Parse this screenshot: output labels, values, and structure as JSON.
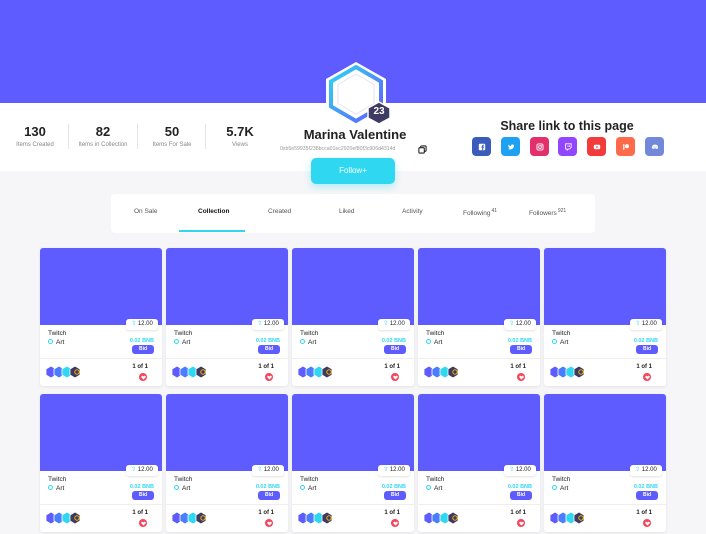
{
  "colors": {
    "brand": "#5e5bff",
    "accent": "#2fd8f0",
    "heart": "#f5455c"
  },
  "profile": {
    "name": "Marina Valentine",
    "address": "0xb5e59935f238bcca01ec2920ef80f3c906d4314d",
    "badge_count": "23",
    "follow_label": "Follow+"
  },
  "stats": [
    {
      "value": "130",
      "label": "Items Created"
    },
    {
      "value": "82",
      "label": "Items in Collection"
    },
    {
      "value": "50",
      "label": "Items For Sale"
    },
    {
      "value": "5.7K",
      "label": "Views"
    }
  ],
  "share": {
    "title": "Share link to this page",
    "networks": [
      {
        "icon": "facebook-icon",
        "color": "#3b5bbd"
      },
      {
        "icon": "twitter-icon",
        "color": "#1ea1f2"
      },
      {
        "icon": "instagram-icon",
        "color": "#e1306c"
      },
      {
        "icon": "twitch-icon",
        "color": "#9146ff"
      },
      {
        "icon": "youtube-icon",
        "color": "#f23b3b"
      },
      {
        "icon": "patreon-icon",
        "color": "#ff6b4a"
      },
      {
        "icon": "discord-icon",
        "color": "#7289da"
      }
    ]
  },
  "tabs": [
    {
      "label": "On Sale",
      "count": ""
    },
    {
      "label": "Collection",
      "count": "",
      "active": true
    },
    {
      "label": "Created",
      "count": ""
    },
    {
      "label": "Liked",
      "count": ""
    },
    {
      "label": "Activity",
      "count": ""
    },
    {
      "label": "Following",
      "count": "41"
    },
    {
      "label": "Followers",
      "count": "921"
    }
  ],
  "cards": [
    {
      "title": "Twitch",
      "category": "Art",
      "price": "12.00",
      "bnb": "0.02 BNB",
      "action": "Bid",
      "edition": "1 of 1"
    },
    {
      "title": "Twitch",
      "category": "Art",
      "price": "12.00",
      "bnb": "0.02 BNB",
      "action": "Bid",
      "edition": "1 of 1"
    },
    {
      "title": "Twitch",
      "category": "Art",
      "price": "12.00",
      "bnb": "0.02 BNB",
      "action": "Bid",
      "edition": "1 of 1"
    },
    {
      "title": "Twitch",
      "category": "Art",
      "price": "12.00",
      "bnb": "0.02 BNB",
      "action": "Bid",
      "edition": "1 of 1"
    },
    {
      "title": "Twitch",
      "category": "Art",
      "price": "12.00",
      "bnb": "0.02 BNB",
      "action": "Bid",
      "edition": "1 of 1"
    },
    {
      "title": "Twitch",
      "category": "Art",
      "price": "12.00",
      "bnb": "0.02 BNB",
      "action": "Bid",
      "edition": "1 of 1"
    },
    {
      "title": "Twitch",
      "category": "Art",
      "price": "12.00",
      "bnb": "0.02 BNB",
      "action": "Bid",
      "edition": "1 of 1"
    },
    {
      "title": "Twitch",
      "category": "Art",
      "price": "12.00",
      "bnb": "0.02 BNB",
      "action": "Bid",
      "edition": "1 of 1"
    },
    {
      "title": "Twitch",
      "category": "Art",
      "price": "12.00",
      "bnb": "0.02 BNB",
      "action": "Bid",
      "edition": "1 of 1"
    },
    {
      "title": "Twitch",
      "category": "Art",
      "price": "12.00",
      "bnb": "0.02 BNB",
      "action": "Bid",
      "edition": "1 of 1"
    }
  ]
}
